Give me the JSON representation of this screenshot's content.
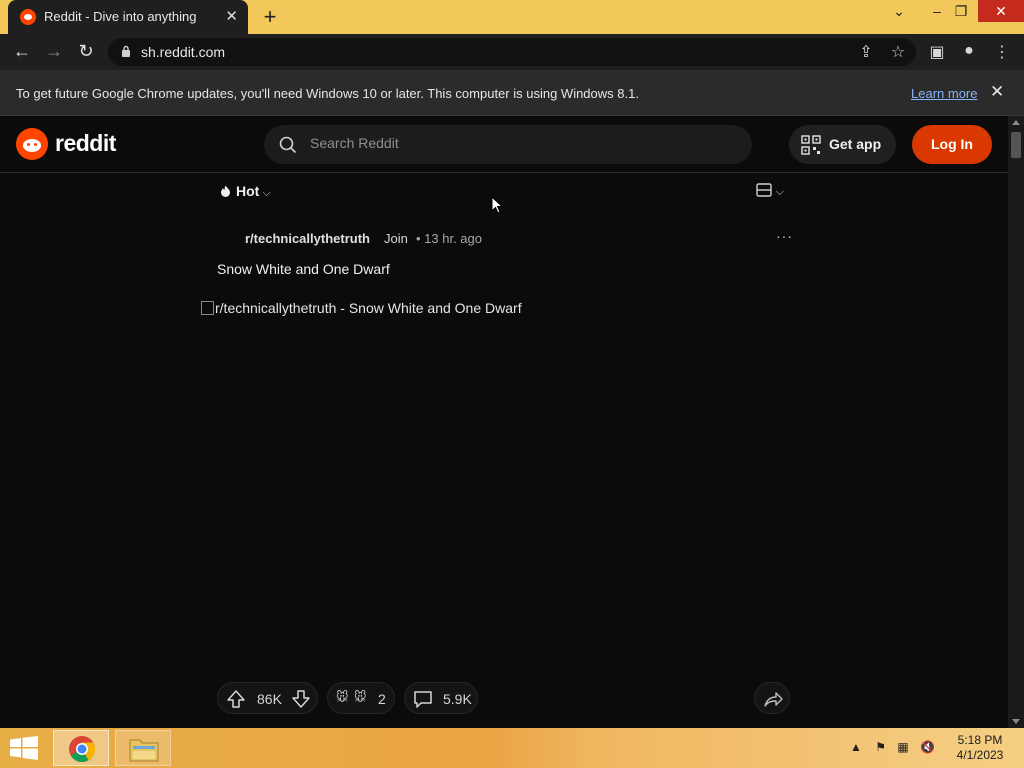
{
  "browser": {
    "tab_title": "Reddit - Dive into anything",
    "url": "sh.reddit.com",
    "infobar_text": "To get future Google Chrome updates, you'll need Windows 10 or later. This computer is using Windows 8.1.",
    "learn_more": "Learn more"
  },
  "reddit": {
    "wordmark": "reddit",
    "search_placeholder": "Search Reddit",
    "get_app": "Get app",
    "login": "Log In",
    "sort_label": "Hot"
  },
  "post": {
    "subreddit": "r/technicallythetruth",
    "join": "Join",
    "age": "• 13 hr. ago",
    "title": "Snow White and One Dwarf",
    "image_alt": "r/technicallythetruth - Snow White and One Dwarf",
    "upvotes": "86K",
    "awards": "2",
    "comments": "5.9K"
  },
  "taskbar": {
    "time": "5:18 PM",
    "date": "4/1/2023"
  },
  "colors": {
    "titlebar": "#f2c85b",
    "reddit_orange": "#ff4500",
    "login_button": "#d93900",
    "page_bg": "#0b0b0b"
  }
}
